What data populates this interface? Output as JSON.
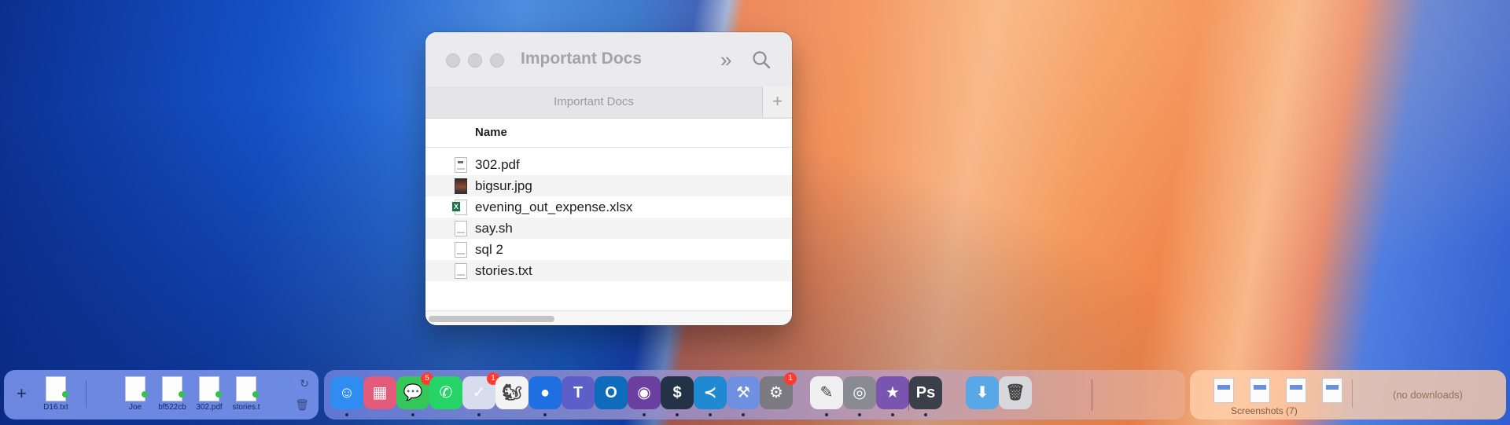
{
  "finder": {
    "title": "Important Docs",
    "tab_label": "Important Docs",
    "tab_add": "+",
    "more_glyph": "»",
    "column_name": "Name",
    "files": [
      {
        "name": "302.pdf",
        "icon": "pdf-file-icon"
      },
      {
        "name": "bigsur.jpg",
        "icon": "image-file-icon"
      },
      {
        "name": "evening_out_expense.xlsx",
        "icon": "excel-file-icon"
      },
      {
        "name": "say.sh",
        "icon": "script-file-icon"
      },
      {
        "name": "sql 2",
        "icon": "generic-file-icon"
      },
      {
        "name": "stories.txt",
        "icon": "text-file-icon"
      }
    ]
  },
  "shelf": {
    "add": "+",
    "files": [
      "D16.txt",
      "Joe",
      "bf522cb",
      "302.pdf",
      "stories.t"
    ],
    "refresh": "↻",
    "trash": "🗑"
  },
  "dock": {
    "apps": [
      {
        "name": "finder",
        "glyph": "☺",
        "color": "#2f8cf0",
        "running": true
      },
      {
        "name": "launchpad",
        "glyph": "▦",
        "color": "#e25b7a",
        "running": false
      },
      {
        "name": "messages",
        "glyph": "💬",
        "color": "#35c759",
        "badge": "5",
        "running": true
      },
      {
        "name": "whatsapp",
        "glyph": "✆",
        "color": "#25d366",
        "running": false
      },
      {
        "name": "tasks",
        "glyph": "✓",
        "color": "#d7dcef",
        "badge": "1",
        "running": true
      },
      {
        "name": "squirrel-app",
        "glyph": "🐿",
        "color": "#f4f4f4",
        "running": false
      },
      {
        "name": "signal-app",
        "glyph": "●",
        "color": "#1f6fe0",
        "running": true
      },
      {
        "name": "teams",
        "glyph": "T",
        "color": "#5b5fc7",
        "running": false
      },
      {
        "name": "outlook",
        "glyph": "O",
        "color": "#0f6cbd",
        "running": false
      },
      {
        "name": "firefox",
        "glyph": "◉",
        "color": "#6b3fa0",
        "running": true
      },
      {
        "name": "terminal",
        "glyph": "$",
        "color": "#243248",
        "running": true
      },
      {
        "name": "vscode",
        "glyph": "≺",
        "color": "#1f8ad2",
        "running": true
      },
      {
        "name": "xcode-tools",
        "glyph": "⚒",
        "color": "#6f8fe0",
        "running": true
      },
      {
        "name": "system-settings",
        "glyph": "⚙",
        "color": "#7a7a80",
        "badge": "1",
        "running": false
      },
      {
        "name": "textedit",
        "glyph": "✎",
        "color": "#f0f0f0",
        "running": true
      },
      {
        "name": "quicktime",
        "glyph": "◎",
        "color": "#8a8a92",
        "running": true
      },
      {
        "name": "imovie",
        "glyph": "★",
        "color": "#7a55b0",
        "running": true
      },
      {
        "name": "photoshop",
        "glyph": "Ps",
        "color": "#3a3f4a",
        "running": true
      },
      {
        "name": "downloads-folder",
        "glyph": "⬇",
        "color": "#58a8e8",
        "running": false
      },
      {
        "name": "trash",
        "glyph": "🗑",
        "color": "#d8d8dc",
        "running": false
      }
    ]
  },
  "screenshots": {
    "caption": "Screenshots (7)",
    "no_downloads": "(no downloads)"
  }
}
